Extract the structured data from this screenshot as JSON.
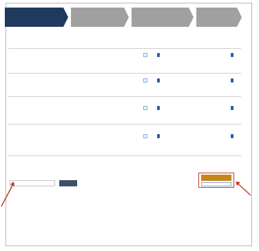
{
  "steps": [
    {
      "num": "",
      "label": "",
      "active": true
    },
    {
      "num": "",
      "label": "",
      "active": false
    },
    {
      "num": "",
      "label": "",
      "active": false
    },
    {
      "num": "",
      "label": "",
      "active": false
    }
  ],
  "table": {
    "headers": [
      "",
      "",
      "",
      "",
      "",
      "",
      "",
      ""
    ],
    "rows": [
      {
        "code": "",
        "name": "",
        "status": "",
        "size": "",
        "qty": "",
        "price": "",
        "disc": "",
        "total": ""
      },
      {
        "code": "",
        "name": "",
        "status": "",
        "size": "",
        "qty": "",
        "price": "",
        "disc": "",
        "total": ""
      },
      {
        "code": "",
        "name": "",
        "status": "",
        "size": "",
        "qty": "",
        "price": "",
        "disc": "",
        "total": ""
      },
      {
        "code": "",
        "name": "",
        "status": "",
        "size": "",
        "qty": "",
        "price": "",
        "disc": "",
        "total": ""
      }
    ],
    "sub_note": ""
  },
  "promo": {
    "text": "",
    "placeholder": "",
    "button": ""
  },
  "summary": {
    "title": "",
    "lines": [
      {
        "label": "",
        "value": ""
      },
      {
        "label": "",
        "value": ""
      },
      {
        "label": "",
        "value": ""
      }
    ]
  },
  "cta": {
    "primary": "",
    "secondary": ""
  },
  "colors": {
    "active_step": "#203a5e",
    "inactive_step": "#a0a0a0",
    "cta": "#c4881a",
    "highlight": "#c0392b",
    "link": "#2a6db8"
  }
}
